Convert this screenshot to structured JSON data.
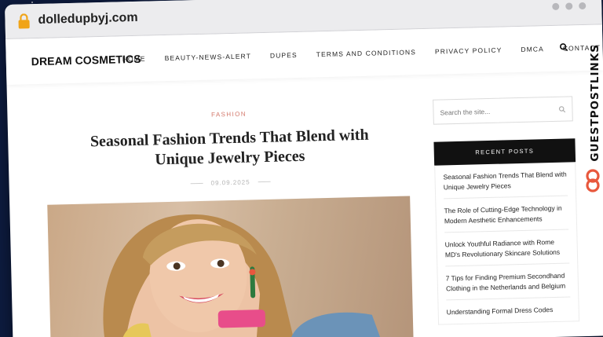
{
  "browser": {
    "url": "dolledupbyj.com"
  },
  "site": {
    "logo": "DREAM COSMETICS",
    "nav": [
      "HOME",
      "BEAUTY-NEWS-ALERT",
      "DUPES",
      "TERMS AND CONDITIONS",
      "PRIVACY POLICY",
      "DMCA",
      "CONTACT US"
    ]
  },
  "article": {
    "category": "FASHION",
    "title": "Seasonal Fashion Trends That Blend with Unique Jewelry Pieces",
    "date": "09.09.2025"
  },
  "sidebar": {
    "search_placeholder": "Search the site...",
    "recent_posts_heading": "RECENT POSTS",
    "recent_posts": [
      "Seasonal Fashion Trends That Blend with Unique Jewelry Pieces",
      "The Role of Cutting-Edge Technology in Modern Aesthetic Enhancements",
      "Unlock Youthful Radiance with Rome MD's Revolutionary Skincare Solutions",
      "7 Tips for Finding Premium Secondhand Clothing in the Netherlands and Belgium",
      "Understanding Formal Dress Codes"
    ]
  },
  "branding": {
    "watermark": "GUESTPOSTLINKS"
  },
  "colors": {
    "page_background": "#0d1b3e",
    "category_accent": "#d3776a",
    "recent_posts_header": "#111111",
    "brand_accent": "#e8583d"
  }
}
